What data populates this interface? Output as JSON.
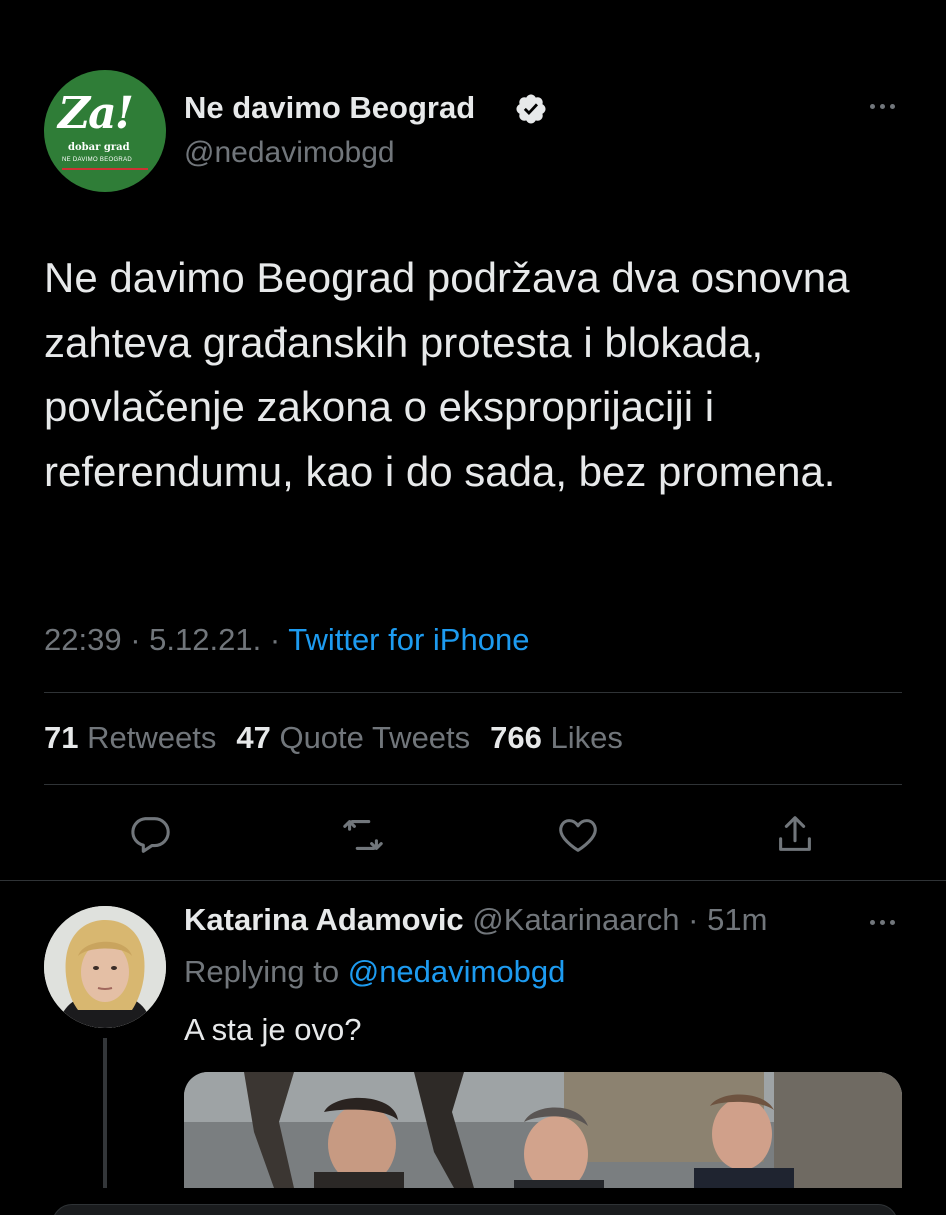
{
  "tweet": {
    "author": {
      "display_name": "Ne davimo Beograd",
      "handle": "@nedavimobgd",
      "verified": true,
      "logo_text": "Za!",
      "logo_sub": "dobar grad",
      "logo_sub2": "NE DAVIMO BEOGRAD"
    },
    "text": "Ne davimo Beograd podržava dva osnovna zahteva građanskih protesta i blokada, povlačenje zakona o eksproprijaciji i referendumu, kao i do sada, bez promena.",
    "time": "22:39",
    "date": "5.12.21.",
    "separator": "·",
    "source": "Twitter for iPhone",
    "stats": {
      "retweets_count": "71",
      "retweets_label": "Retweets",
      "quotes_count": "47",
      "quotes_label": "Quote Tweets",
      "likes_count": "766",
      "likes_label": "Likes"
    }
  },
  "reply": {
    "display_name": "Katarina Adamovic",
    "handle": "@Katarinaarch",
    "separator": "·",
    "age": "51m",
    "replying_label": "Replying to",
    "replying_to": "@nedavimobgd",
    "text": "A sta je ovo?"
  },
  "colors": {
    "background": "#000000",
    "primary_text": "#e7e9ea",
    "secondary_text": "#71767b",
    "link": "#1d9bf0",
    "logo_green": "#2f7d37"
  },
  "icons": [
    "verified-badge-icon",
    "more-icon",
    "reply-icon",
    "retweet-icon",
    "like-icon",
    "share-icon"
  ]
}
